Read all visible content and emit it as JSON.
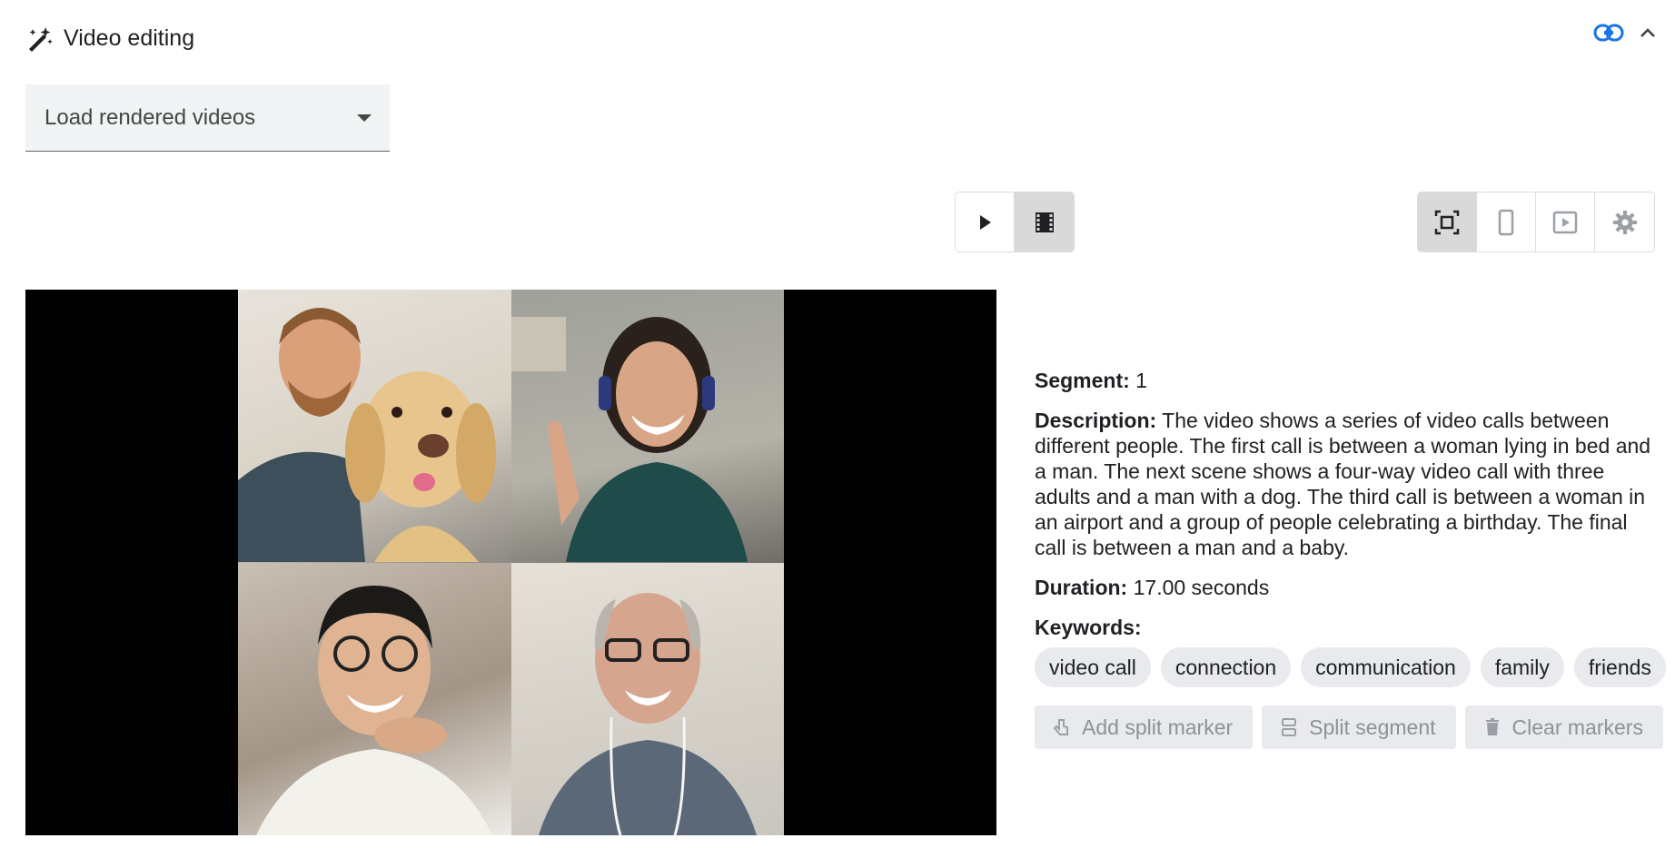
{
  "header": {
    "title": "Video editing"
  },
  "select": {
    "value": "Load rendered videos"
  },
  "player": {
    "play_label": "play",
    "frames_label": "frames"
  },
  "view": {
    "fit_label": "fit",
    "phone_label": "phone",
    "preview_label": "preview",
    "settings_label": "settings"
  },
  "segment": {
    "segment_label": "Segment:",
    "segment_value": " 1",
    "description_label": "Description:",
    "description_value": " The video shows a series of video calls between different people. The first call is between a woman lying in bed and a man. The next scene shows a four-way video call with three adults and a man with a dog. The third call is between a woman in an airport and a group of people celebrating a birthday. The final call is between a man and a baby.",
    "duration_label": "Duration:",
    "duration_value": " 17.00 seconds",
    "keywords_label": "Keywords:",
    "keywords": [
      "video call",
      "connection",
      "communication",
      "family",
      "friends"
    ]
  },
  "actions": {
    "add_split": "Add split marker",
    "split_segment": "Split segment",
    "clear_markers": "Clear markers"
  }
}
